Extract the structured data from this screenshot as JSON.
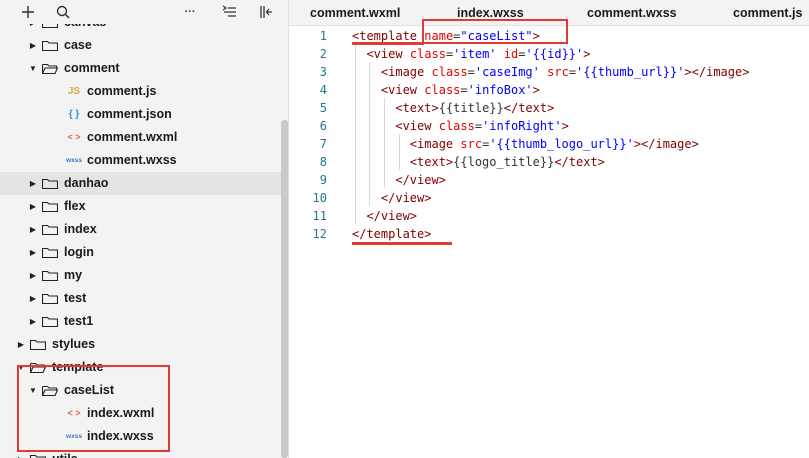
{
  "sidebar": {
    "toolbar": {
      "add_icon": "plus-icon",
      "search_icon": "search-icon",
      "more_icon": "ellipsis-icon",
      "collapse_icon": "collapse-list-icon",
      "layout_icon": "split-left-icon",
      "more_text": "···"
    },
    "tree": [
      {
        "label": "canvas",
        "kind": "folder",
        "depth": 1,
        "open": false
      },
      {
        "label": "case",
        "kind": "folder",
        "depth": 1,
        "open": false
      },
      {
        "label": "comment",
        "kind": "folder",
        "depth": 1,
        "open": true
      },
      {
        "label": "comment.js",
        "kind": "js",
        "depth": 2,
        "icon_text": "JS"
      },
      {
        "label": "comment.json",
        "kind": "json",
        "depth": 2,
        "icon_text": "{ }"
      },
      {
        "label": "comment.wxml",
        "kind": "wxml",
        "depth": 2,
        "icon_text": "< >"
      },
      {
        "label": "comment.wxss",
        "kind": "wxss",
        "depth": 2,
        "icon_text": "wxss"
      },
      {
        "label": "danhao",
        "kind": "folder",
        "depth": 1,
        "open": false,
        "selected": true
      },
      {
        "label": "flex",
        "kind": "folder",
        "depth": 1,
        "open": false
      },
      {
        "label": "index",
        "kind": "folder",
        "depth": 1,
        "open": false
      },
      {
        "label": "login",
        "kind": "folder",
        "depth": 1,
        "open": false
      },
      {
        "label": "my",
        "kind": "folder",
        "depth": 1,
        "open": false
      },
      {
        "label": "test",
        "kind": "folder",
        "depth": 1,
        "open": false
      },
      {
        "label": "test1",
        "kind": "folder",
        "depth": 1,
        "open": false
      },
      {
        "label": "stylues",
        "kind": "folder",
        "depth": 0,
        "open": false
      },
      {
        "label": "template",
        "kind": "folder",
        "depth": 0,
        "open": true
      },
      {
        "label": "caseList",
        "kind": "folder",
        "depth": 1,
        "open": true
      },
      {
        "label": "index.wxml",
        "kind": "wxml",
        "depth": 2,
        "icon_text": "< >"
      },
      {
        "label": "index.wxss",
        "kind": "wxss",
        "depth": 2,
        "icon_text": "wxss"
      },
      {
        "label": "utils",
        "kind": "folder",
        "depth": 0,
        "open": false
      }
    ]
  },
  "tabs": [
    {
      "label": "comment.wxml"
    },
    {
      "label": "index.wxss"
    },
    {
      "label": "comment.wxss"
    },
    {
      "label": "comment.js"
    }
  ],
  "editor": {
    "lines": [
      {
        "n": "1",
        "tokens": [
          [
            "t",
            "<template"
          ],
          [
            "d",
            " "
          ],
          [
            "a",
            "name"
          ],
          [
            "d",
            "="
          ],
          [
            "s",
            "\"caseList\""
          ],
          [
            "t",
            ">"
          ]
        ]
      },
      {
        "n": "2",
        "tokens": [
          [
            "d",
            "  "
          ],
          [
            "t",
            "<view"
          ],
          [
            "d",
            " "
          ],
          [
            "a",
            "class"
          ],
          [
            "d",
            "="
          ],
          [
            "s",
            "'item'"
          ],
          [
            "d",
            " "
          ],
          [
            "a",
            "id"
          ],
          [
            "d",
            "="
          ],
          [
            "s",
            "'{{id}}'"
          ],
          [
            "t",
            ">"
          ]
        ]
      },
      {
        "n": "3",
        "tokens": [
          [
            "d",
            "    "
          ],
          [
            "t",
            "<image"
          ],
          [
            "d",
            " "
          ],
          [
            "a",
            "class"
          ],
          [
            "d",
            "="
          ],
          [
            "s",
            "'caseImg'"
          ],
          [
            "d",
            " "
          ],
          [
            "a",
            "src"
          ],
          [
            "d",
            "="
          ],
          [
            "s",
            "'{{thumb_url}}'"
          ],
          [
            "t",
            "></image>"
          ]
        ]
      },
      {
        "n": "4",
        "tokens": [
          [
            "d",
            "    "
          ],
          [
            "t",
            "<view"
          ],
          [
            "d",
            " "
          ],
          [
            "a",
            "class"
          ],
          [
            "d",
            "="
          ],
          [
            "s",
            "'infoBox'"
          ],
          [
            "t",
            ">"
          ]
        ]
      },
      {
        "n": "5",
        "tokens": [
          [
            "d",
            "      "
          ],
          [
            "t",
            "<text>"
          ],
          [
            "d",
            "{{title}}"
          ],
          [
            "t",
            "</text>"
          ]
        ]
      },
      {
        "n": "6",
        "tokens": [
          [
            "d",
            "      "
          ],
          [
            "t",
            "<view"
          ],
          [
            "d",
            " "
          ],
          [
            "a",
            "class"
          ],
          [
            "d",
            "="
          ],
          [
            "s",
            "'infoRight'"
          ],
          [
            "t",
            ">"
          ]
        ]
      },
      {
        "n": "7",
        "tokens": [
          [
            "d",
            "        "
          ],
          [
            "t",
            "<image"
          ],
          [
            "d",
            " "
          ],
          [
            "a",
            "src"
          ],
          [
            "d",
            "="
          ],
          [
            "s",
            "'{{thumb_logo_url}}'"
          ],
          [
            "t",
            "></image>"
          ]
        ]
      },
      {
        "n": "8",
        "tokens": [
          [
            "d",
            "        "
          ],
          [
            "t",
            "<text>"
          ],
          [
            "d",
            "{{logo_title}}"
          ],
          [
            "t",
            "</text>"
          ]
        ]
      },
      {
        "n": "9",
        "tokens": [
          [
            "d",
            "      "
          ],
          [
            "t",
            "</view>"
          ]
        ]
      },
      {
        "n": "10",
        "tokens": [
          [
            "d",
            "    "
          ],
          [
            "t",
            "</view>"
          ]
        ]
      },
      {
        "n": "11",
        "tokens": [
          [
            "d",
            "  "
          ],
          [
            "t",
            "</view>"
          ]
        ]
      },
      {
        "n": "12",
        "tokens": [
          [
            "t",
            "</template>"
          ]
        ]
      }
    ]
  },
  "colors": {
    "annotation": "#e53935",
    "tag": "#800000",
    "attribute": "#e50000",
    "string": "#0000ff",
    "line_number": "#237893"
  }
}
